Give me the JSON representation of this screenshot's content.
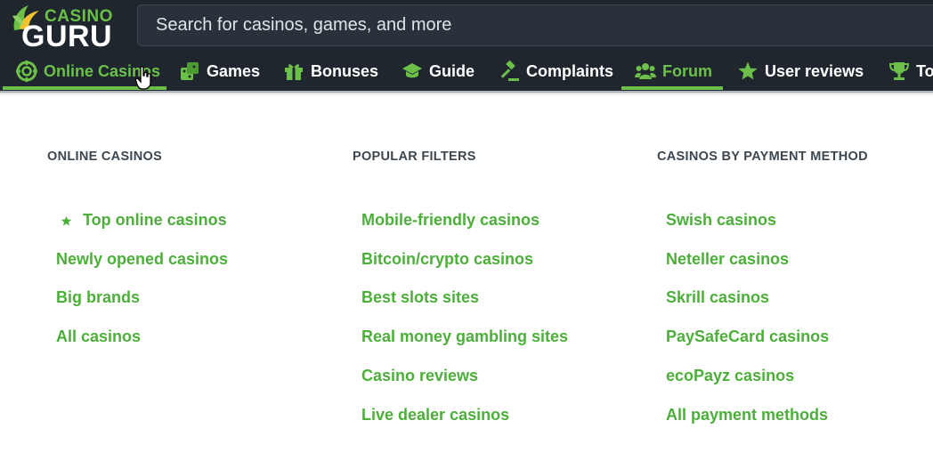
{
  "brand": {
    "line1": "CASINO",
    "line2": "GURU"
  },
  "search": {
    "placeholder": "Search for casinos, games, and more"
  },
  "nav": [
    {
      "label": "Online Casinos",
      "icon": "chip-icon",
      "active": true
    },
    {
      "label": "Games",
      "icon": "dice-icon"
    },
    {
      "label": "Bonuses",
      "icon": "gift-icon"
    },
    {
      "label": "Guide",
      "icon": "graduation-cap-icon"
    },
    {
      "label": "Complaints",
      "icon": "gavel-icon"
    },
    {
      "label": "Forum",
      "icon": "users-icon",
      "active": true
    },
    {
      "label": "User reviews",
      "icon": "star-icon"
    },
    {
      "label": "To",
      "icon": "trophy-icon"
    }
  ],
  "columns": [
    {
      "heading": "ONLINE CASINOS",
      "links": [
        "Top online casinos",
        "Newly opened casinos",
        "Big brands",
        "All casinos"
      ]
    },
    {
      "heading": "POPULAR FILTERS",
      "links": [
        "Mobile-friendly casinos",
        "Bitcoin/crypto casinos",
        "Best slots sites",
        "Real money gambling sites",
        "Casino reviews",
        "Live dealer casinos"
      ]
    },
    {
      "heading": "CASINOS BY PAYMENT METHOD",
      "links": [
        "Swish casinos",
        "Neteller casinos",
        "Skrill casinos",
        "PaySafeCard casinos",
        "ecoPayz casinos",
        "All payment methods"
      ]
    }
  ],
  "colors": {
    "green": "#6cc04a",
    "link_green": "#4caf3a",
    "topbar": "#1f262e",
    "heading": "#3d4750"
  }
}
